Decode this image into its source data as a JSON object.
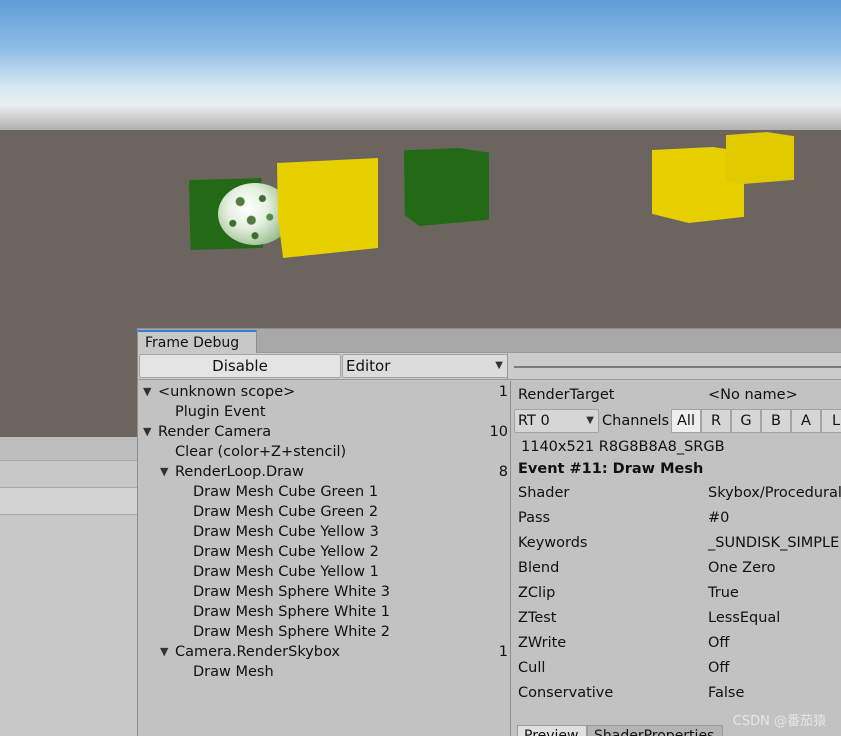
{
  "window": {
    "tab_title": "Frame Debug"
  },
  "toolbar": {
    "disable_label": "Disable",
    "editor_label": "Editor"
  },
  "tree": [
    {
      "label": "<unknown scope>",
      "expanded": true,
      "count": "1"
    },
    {
      "label": "Plugin Event",
      "count": ""
    },
    {
      "label": "Render Camera",
      "expanded": true,
      "count": "10"
    },
    {
      "label": "Clear (color+Z+stencil)",
      "count": ""
    },
    {
      "label": "RenderLoop.Draw",
      "expanded": true,
      "count": "8"
    },
    {
      "label": "Draw Mesh Cube Green 1",
      "count": ""
    },
    {
      "label": "Draw Mesh Cube Green 2",
      "count": ""
    },
    {
      "label": "Draw Mesh Cube Yellow 3",
      "count": ""
    },
    {
      "label": "Draw Mesh Cube Yellow 2",
      "count": ""
    },
    {
      "label": "Draw Mesh Cube Yellow 1",
      "count": ""
    },
    {
      "label": "Draw Mesh Sphere White 3",
      "count": ""
    },
    {
      "label": "Draw Mesh Sphere White 1",
      "count": ""
    },
    {
      "label": "Draw Mesh Sphere White 2",
      "count": ""
    },
    {
      "label": "Camera.RenderSkybox",
      "expanded": true,
      "count": "1"
    },
    {
      "label": "Draw Mesh",
      "count": ""
    }
  ],
  "detail": {
    "render_target_label": "RenderTarget",
    "render_target_value": "<No name>",
    "rt_select": "RT 0",
    "channels_label": "Channels",
    "channels": [
      "All",
      "R",
      "G",
      "B",
      "A",
      "L"
    ],
    "format": "1140x521 R8G8B8A8_SRGB",
    "event_title": "Event #11: Draw Mesh",
    "properties": [
      {
        "label": "Shader",
        "value": "Skybox/Procedural"
      },
      {
        "label": "Pass",
        "value": "#0"
      },
      {
        "label": "Keywords",
        "value": "_SUNDISK_SIMPLE"
      },
      {
        "label": "Blend",
        "value": "One Zero"
      },
      {
        "label": "ZClip",
        "value": "True"
      },
      {
        "label": "ZTest",
        "value": "LessEqual"
      },
      {
        "label": "ZWrite",
        "value": "Off"
      },
      {
        "label": "Cull",
        "value": "Off"
      },
      {
        "label": "Conservative",
        "value": "False"
      }
    ],
    "bottom_tabs": [
      "Preview",
      "ShaderProperties"
    ]
  },
  "watermark": "CSDN @番茄猿"
}
